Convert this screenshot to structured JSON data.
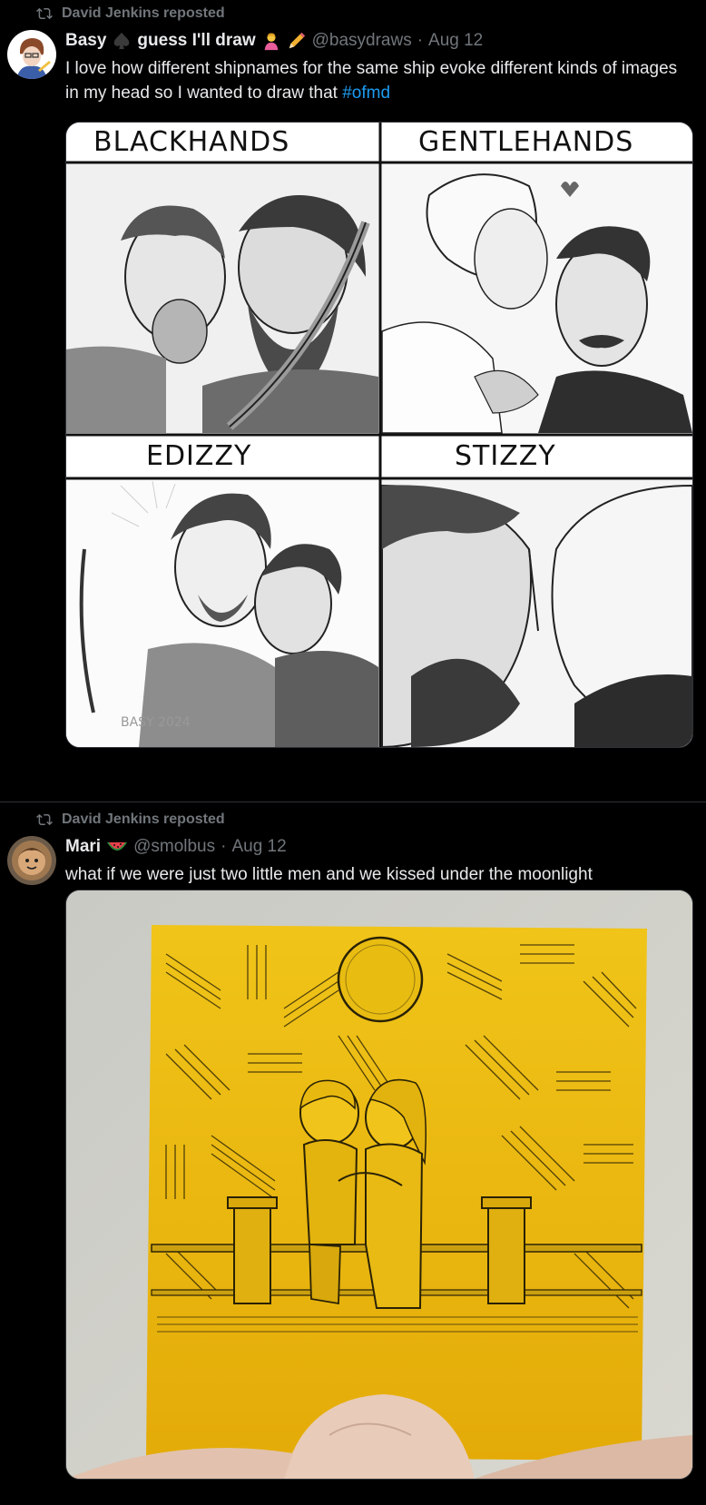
{
  "tweets": [
    {
      "repost_label": "David Jenkins reposted",
      "display_name": "Basy",
      "name_suffix": "guess I'll draw",
      "handle": "@basydraws",
      "dot": "·",
      "date": "Aug 12",
      "text_before_tag": "I love how different shipnames for the same ship evoke different kinds of images in my head so I wanted to draw that ",
      "hashtag": "#ofmd",
      "panels": [
        "BLACKHANDS",
        "GENTLEHANDS",
        "EDIZZY",
        "STIZZY"
      ],
      "signature": "BASY 2024"
    },
    {
      "repost_label": "David Jenkins reposted",
      "display_name": "Mari",
      "handle": "@smolbus",
      "dot": "·",
      "date": "Aug 12",
      "text": "what if we were just two little men and we kissed under the moonlight"
    }
  ],
  "icons": {
    "repost": "repost-icon",
    "spade": "spade-icon",
    "person_emoji": "person-tipping-hand-icon",
    "pencil_emoji": "pencil-icon",
    "watermelon": "watermelon-icon"
  },
  "colors": {
    "background": "#000000",
    "text": "#e7e9ea",
    "muted": "#71767b",
    "link": "#1d9bf0",
    "postit": "#e8b90c"
  }
}
